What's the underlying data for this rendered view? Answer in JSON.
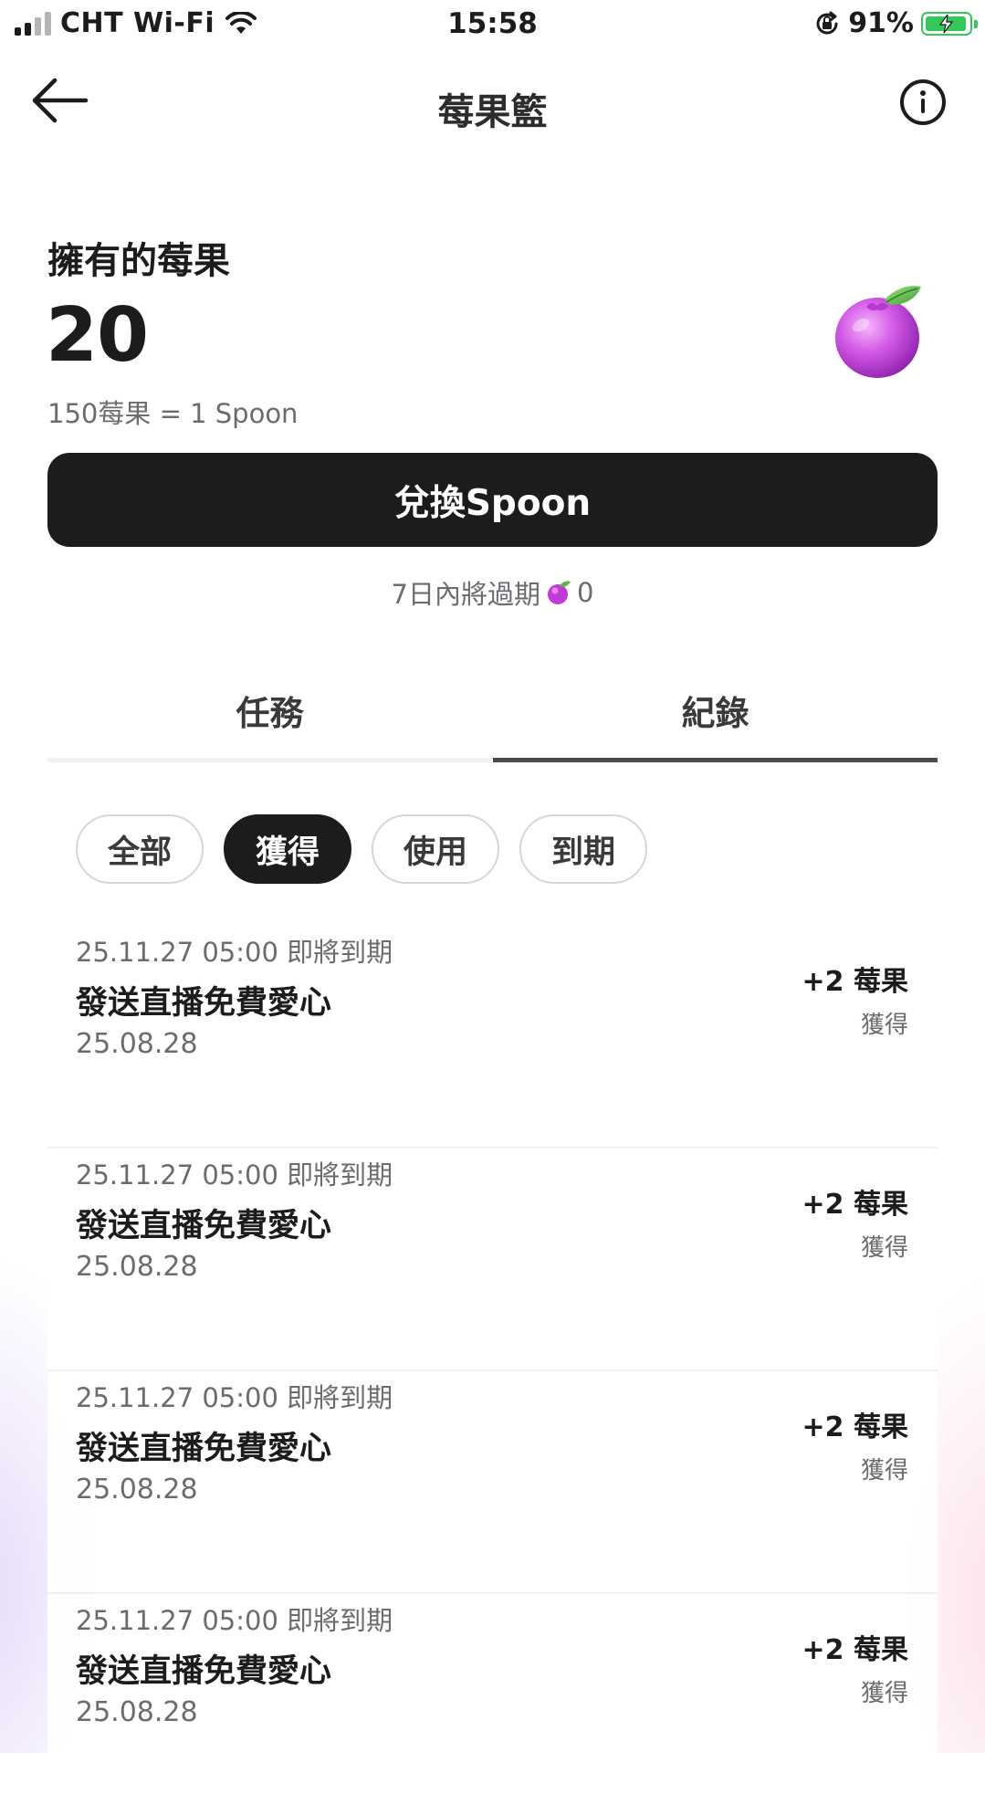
{
  "status_bar": {
    "carrier": "CHT Wi-Fi",
    "time": "15:58",
    "battery_percent": "91%"
  },
  "header": {
    "title": "莓果籃",
    "back_icon": "arrow-left-icon",
    "info_icon": "info-circle-icon"
  },
  "balance": {
    "label": "擁有的莓果",
    "value": "20",
    "rate": "150莓果 = 1 Spoon",
    "icon": "berry-icon"
  },
  "exchange_button": {
    "label": "兌換Spoon"
  },
  "expiry_notice": {
    "text": "7日內將過期",
    "count": "0"
  },
  "tabs": [
    {
      "label": "任務",
      "active": false
    },
    {
      "label": "紀錄",
      "active": true
    }
  ],
  "filters": [
    {
      "label": "全部",
      "active": false
    },
    {
      "label": "獲得",
      "active": true
    },
    {
      "label": "使用",
      "active": false
    },
    {
      "label": "到期",
      "active": false
    }
  ],
  "records": [
    {
      "expiry": "25.11.27 05:00 即將到期",
      "title": "發送直播免費愛心",
      "date": "25.08.28",
      "amount": "+2 莓果",
      "type": "獲得"
    },
    {
      "expiry": "25.11.27 05:00 即將到期",
      "title": "發送直播免費愛心",
      "date": "25.08.28",
      "amount": "+2 莓果",
      "type": "獲得"
    },
    {
      "expiry": "25.11.27 05:00 即將到期",
      "title": "發送直播免費愛心",
      "date": "25.08.28",
      "amount": "+2 莓果",
      "type": "獲得"
    },
    {
      "expiry": "25.11.27 05:00 即將到期",
      "title": "發送直播免費愛心",
      "date": "25.08.28",
      "amount": "+2 莓果",
      "type": "獲得"
    }
  ],
  "colors": {
    "primary_dark": "#1c1c1e",
    "secondary_text": "#6b6b70",
    "berry": "#c13ad8",
    "battery": "#34c759"
  }
}
